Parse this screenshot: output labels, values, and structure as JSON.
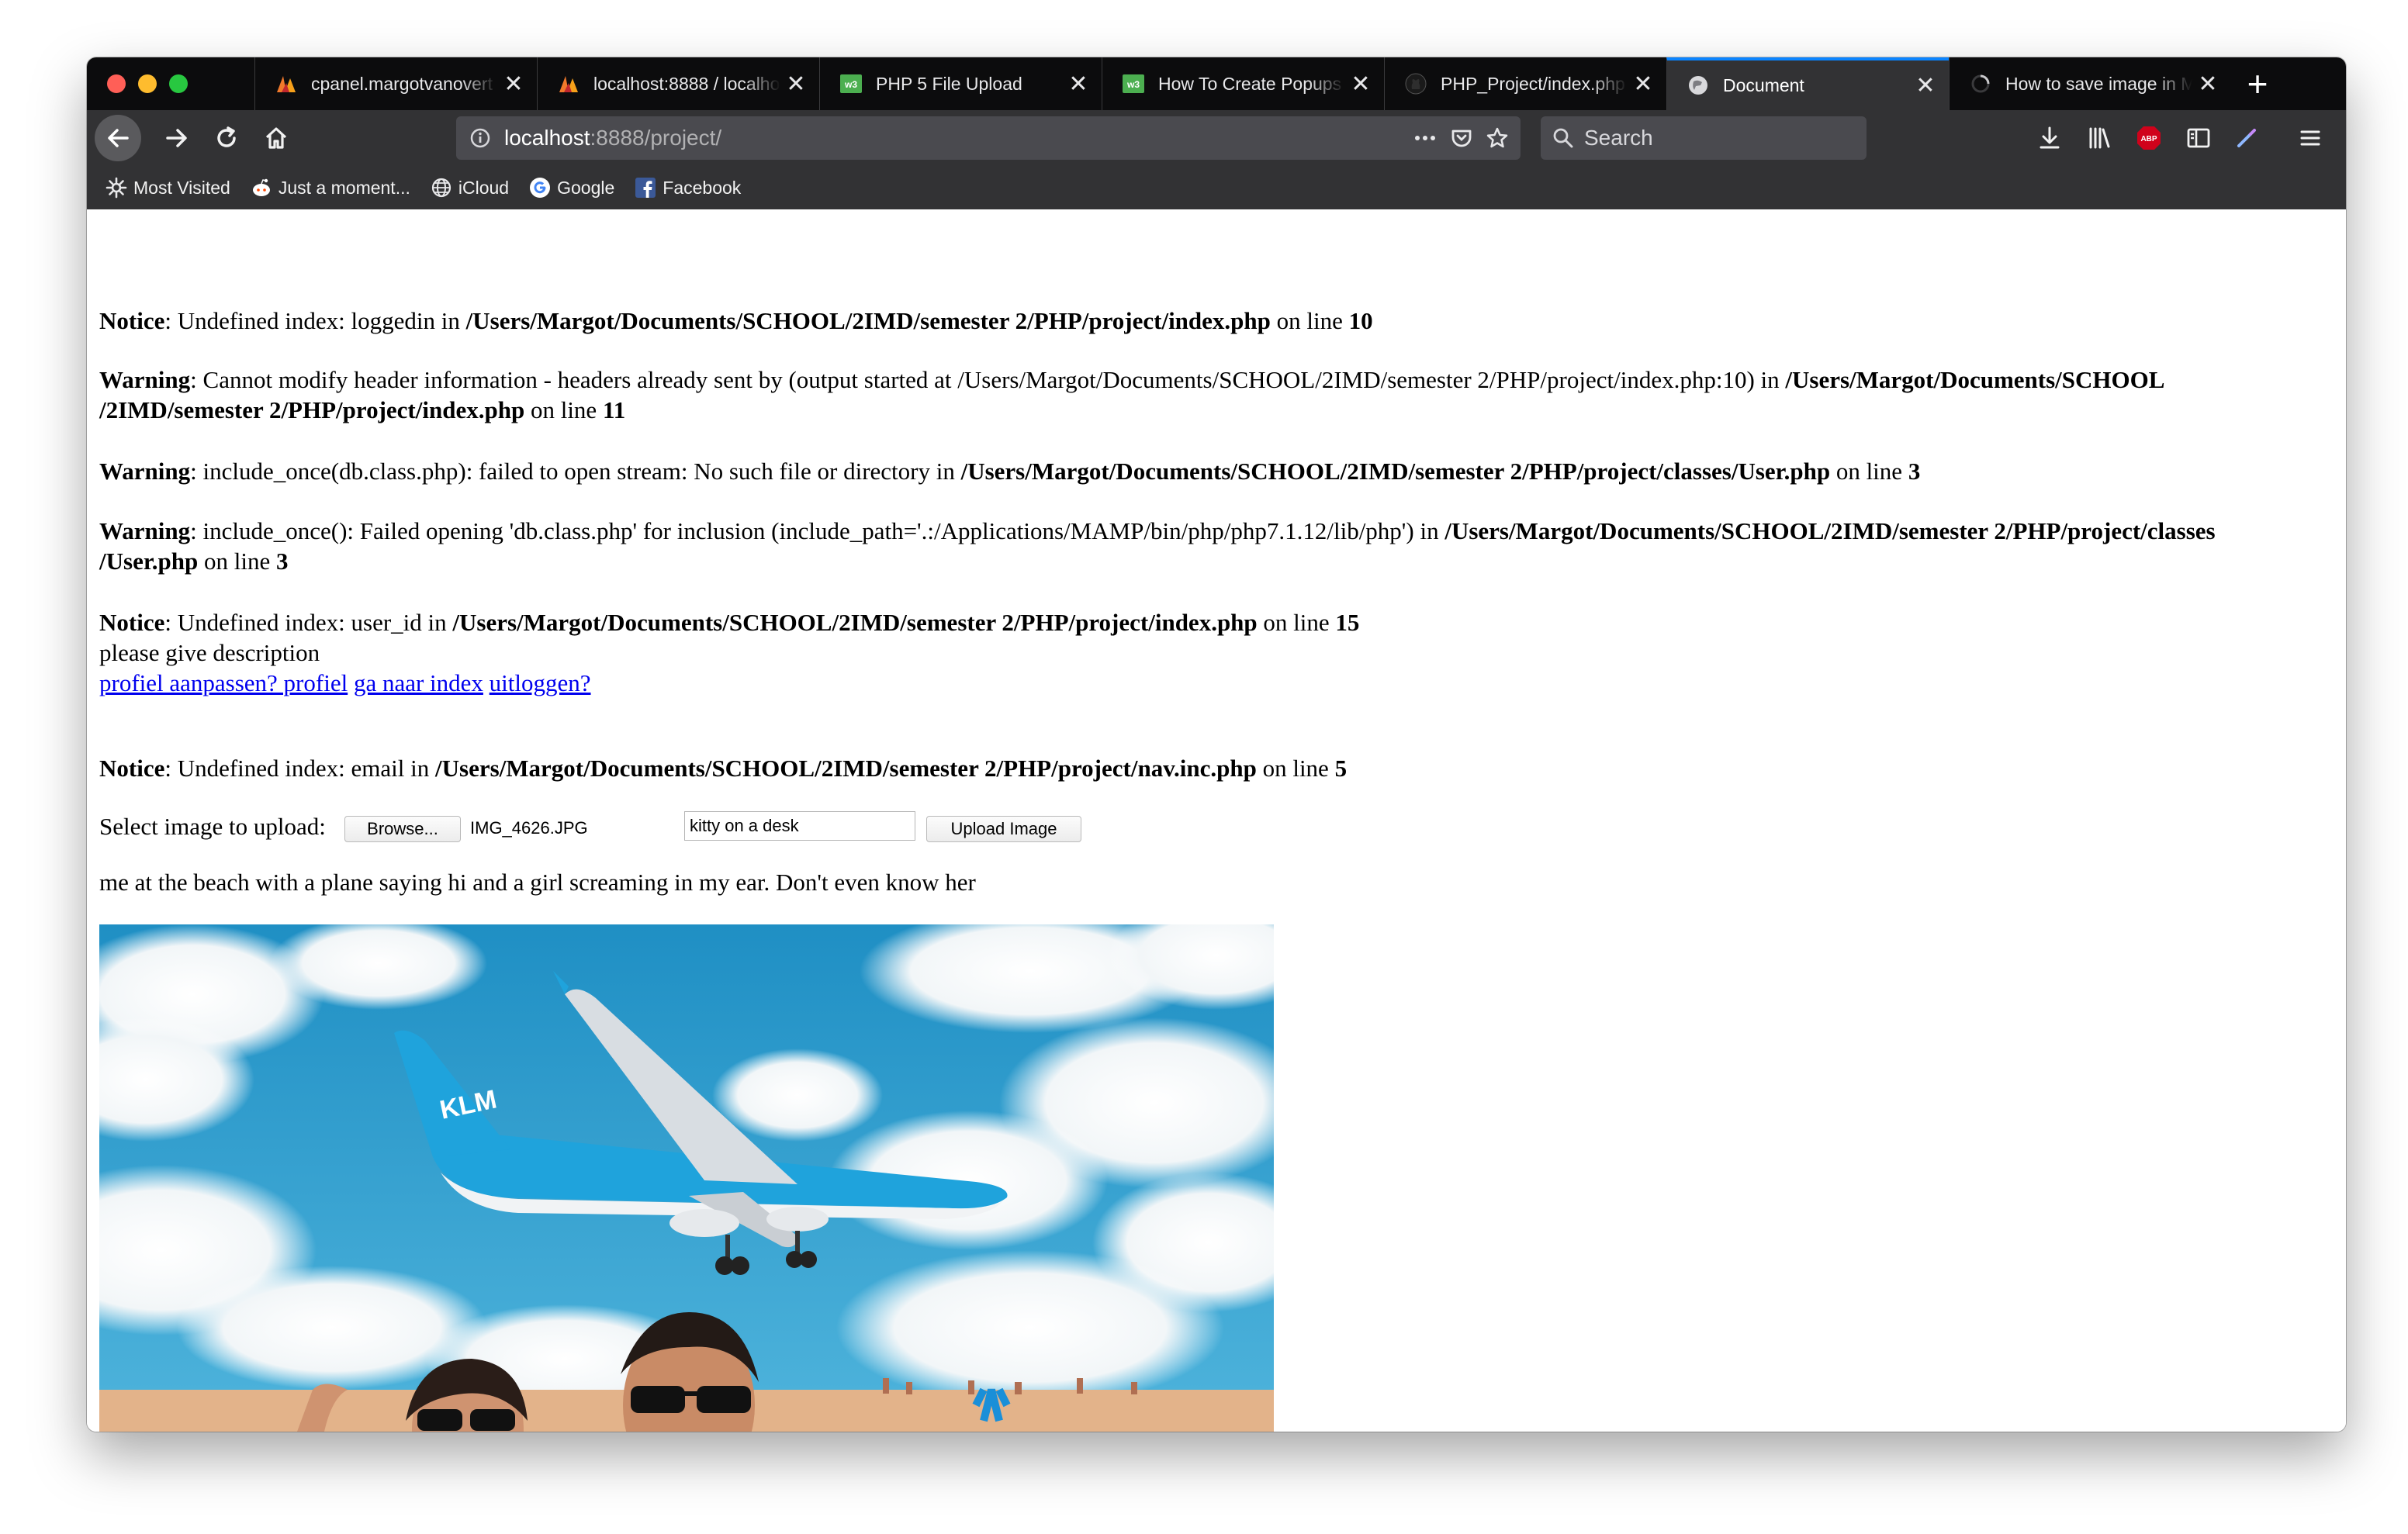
{
  "browser": {
    "tabs": [
      {
        "title": "cpanel.margotvanovert",
        "icon": "cpanel-icon",
        "active": false
      },
      {
        "title": "localhost:8888 / localhost",
        "icon": "phpmyadmin-icon",
        "active": false
      },
      {
        "title": "PHP 5 File Upload",
        "icon": "w3schools-icon",
        "active": false
      },
      {
        "title": "How To Create Popups",
        "icon": "w3schools-icon",
        "active": false
      },
      {
        "title": "PHP_Project/index.php",
        "icon": "github-icon",
        "active": false
      },
      {
        "title": "Document",
        "icon": "globe-icon",
        "active": true
      },
      {
        "title": "How to save image in MySQL",
        "icon": "spinner-icon",
        "active": false
      }
    ],
    "tab_close_glyph": "✕",
    "new_tab_glyph": "+",
    "url": {
      "host": "localhost",
      "rest": ":8888/project/"
    },
    "search_placeholder": "Search",
    "bookmarks": [
      {
        "label": "Most Visited",
        "icon": "gear-icon"
      },
      {
        "label": "Just a moment...",
        "icon": "reddit-icon"
      },
      {
        "label": "iCloud",
        "icon": "globe-icon"
      },
      {
        "label": "Google",
        "icon": "google-icon"
      },
      {
        "label": "Facebook",
        "icon": "facebook-icon"
      }
    ]
  },
  "page": {
    "messages": [
      {
        "type": "Notice",
        "text": ": Undefined index: loggedin in ",
        "path": "/Users/Margot/Documents/SCHOOL/2IMD/semester 2/PHP/project/index.php",
        "line_label": " on line ",
        "line": "10"
      },
      {
        "type": "Warning",
        "text": ": Cannot modify header information - headers already sent by (output started at /Users/Margot/Documents/SCHOOL/2IMD/semester 2/PHP/project/index.php:10) in ",
        "path_a": "/Users/Margot/Documents/SCHOOL",
        "path_b": "/2IMD/semester 2/PHP/project/index.php",
        "line_label": " on line ",
        "line": "11"
      },
      {
        "type": "Warning",
        "text": ": include_once(db.class.php): failed to open stream: No such file or directory in ",
        "path": "/Users/Margot/Documents/SCHOOL/2IMD/semester 2/PHP/project/classes/User.php",
        "line_label": " on line ",
        "line": "3"
      },
      {
        "type": "Warning",
        "text": ": include_once(): Failed opening 'db.class.php' for inclusion (include_path='.:/Applications/MAMP/bin/php/php7.1.12/lib/php') in ",
        "path_a": "/Users/Margot/Documents/SCHOOL/2IMD/semester 2/PHP/project/classes",
        "path_b": "/User.php",
        "line_label": " on line ",
        "line": "3"
      },
      {
        "type": "Notice",
        "text": ": Undefined index: user_id in ",
        "path": "/Users/Margot/Documents/SCHOOL/2IMD/semester 2/PHP/project/index.php",
        "line_label": " on line ",
        "line": "15"
      },
      {
        "type": "Notice",
        "text": ": Undefined index: email in ",
        "path": "/Users/Margot/Documents/SCHOOL/2IMD/semester 2/PHP/project/nav.inc.php",
        "line_label": " on line ",
        "line": "5"
      }
    ],
    "description_prompt": "please give description",
    "links": {
      "edit_profile": "profiel aanpassen? profiel",
      "to_index": "ga naar index",
      "logout": "uitloggen?"
    },
    "upload": {
      "label": "Select image to upload:",
      "browse_button": "Browse...",
      "file_name": "IMG_4626.JPG",
      "description_value": "kitty on a desk",
      "submit_button": "Upload Image"
    },
    "caption": "me at the beach with a plane saying hi and a girl screaming in my ear. Don't even know her",
    "photo_logo": "KLM"
  }
}
